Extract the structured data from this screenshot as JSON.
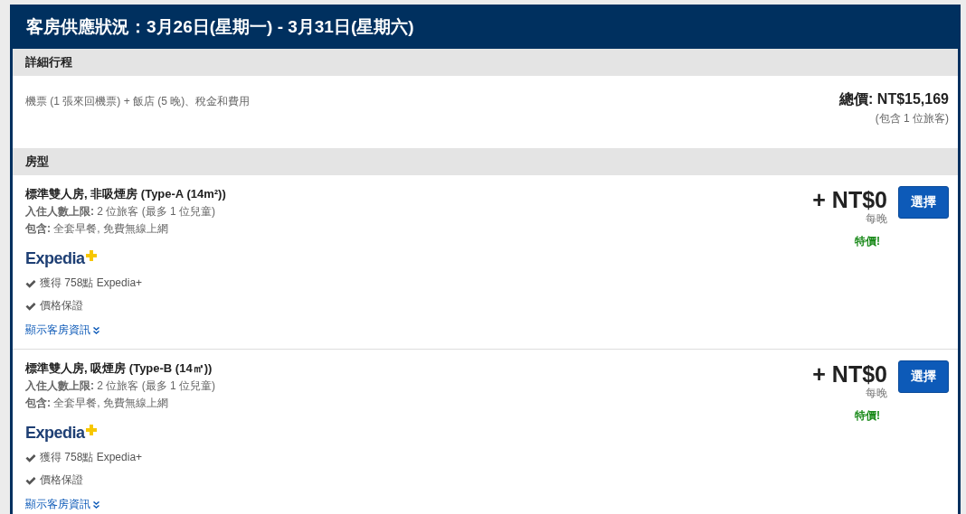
{
  "header": {
    "title": "客房供應狀況：3月26日(星期一) - 3月31日(星期六)"
  },
  "itinerary": {
    "heading": "詳細行程",
    "description": "機票 (1 張來回機票) + 飯店 (5 晚)、稅金和費用",
    "total": "總價: NT$15,169",
    "total_note": "(包含 1 位旅客)"
  },
  "rooms_heading": "房型",
  "rooms": [
    {
      "name": "標準雙人房, 非吸煙房 (Type-A (14m²))",
      "occupancy": "**入住人數上限:** 2 位旅客 (最多 1 位兒童)",
      "includes": "**包含:** 全套早餐, 免費無線上網",
      "logo": "Expedia",
      "perks": [
        "獲得 758點 Expedia+",
        "價格保證"
      ],
      "details_link": "顯示客房資訊",
      "price": "+ NT$0",
      "price_unit": "每晚",
      "deal": "特價!",
      "button": "選擇"
    },
    {
      "name": "標準雙人房, 吸煙房 (Type-B (14㎡))",
      "occupancy": "**入住人數上限:** 2 位旅客 (最多 1 位兒童)",
      "includes": "**包含:** 全套早餐, 免費無線上網",
      "logo": "Expedia",
      "perks": [
        "獲得 758點 Expedia+",
        "價格保證"
      ],
      "details_link": "顯示客房資訊",
      "price": "+ NT$0",
      "price_unit": "每晚",
      "deal": "特價!",
      "button": "選擇"
    }
  ]
}
